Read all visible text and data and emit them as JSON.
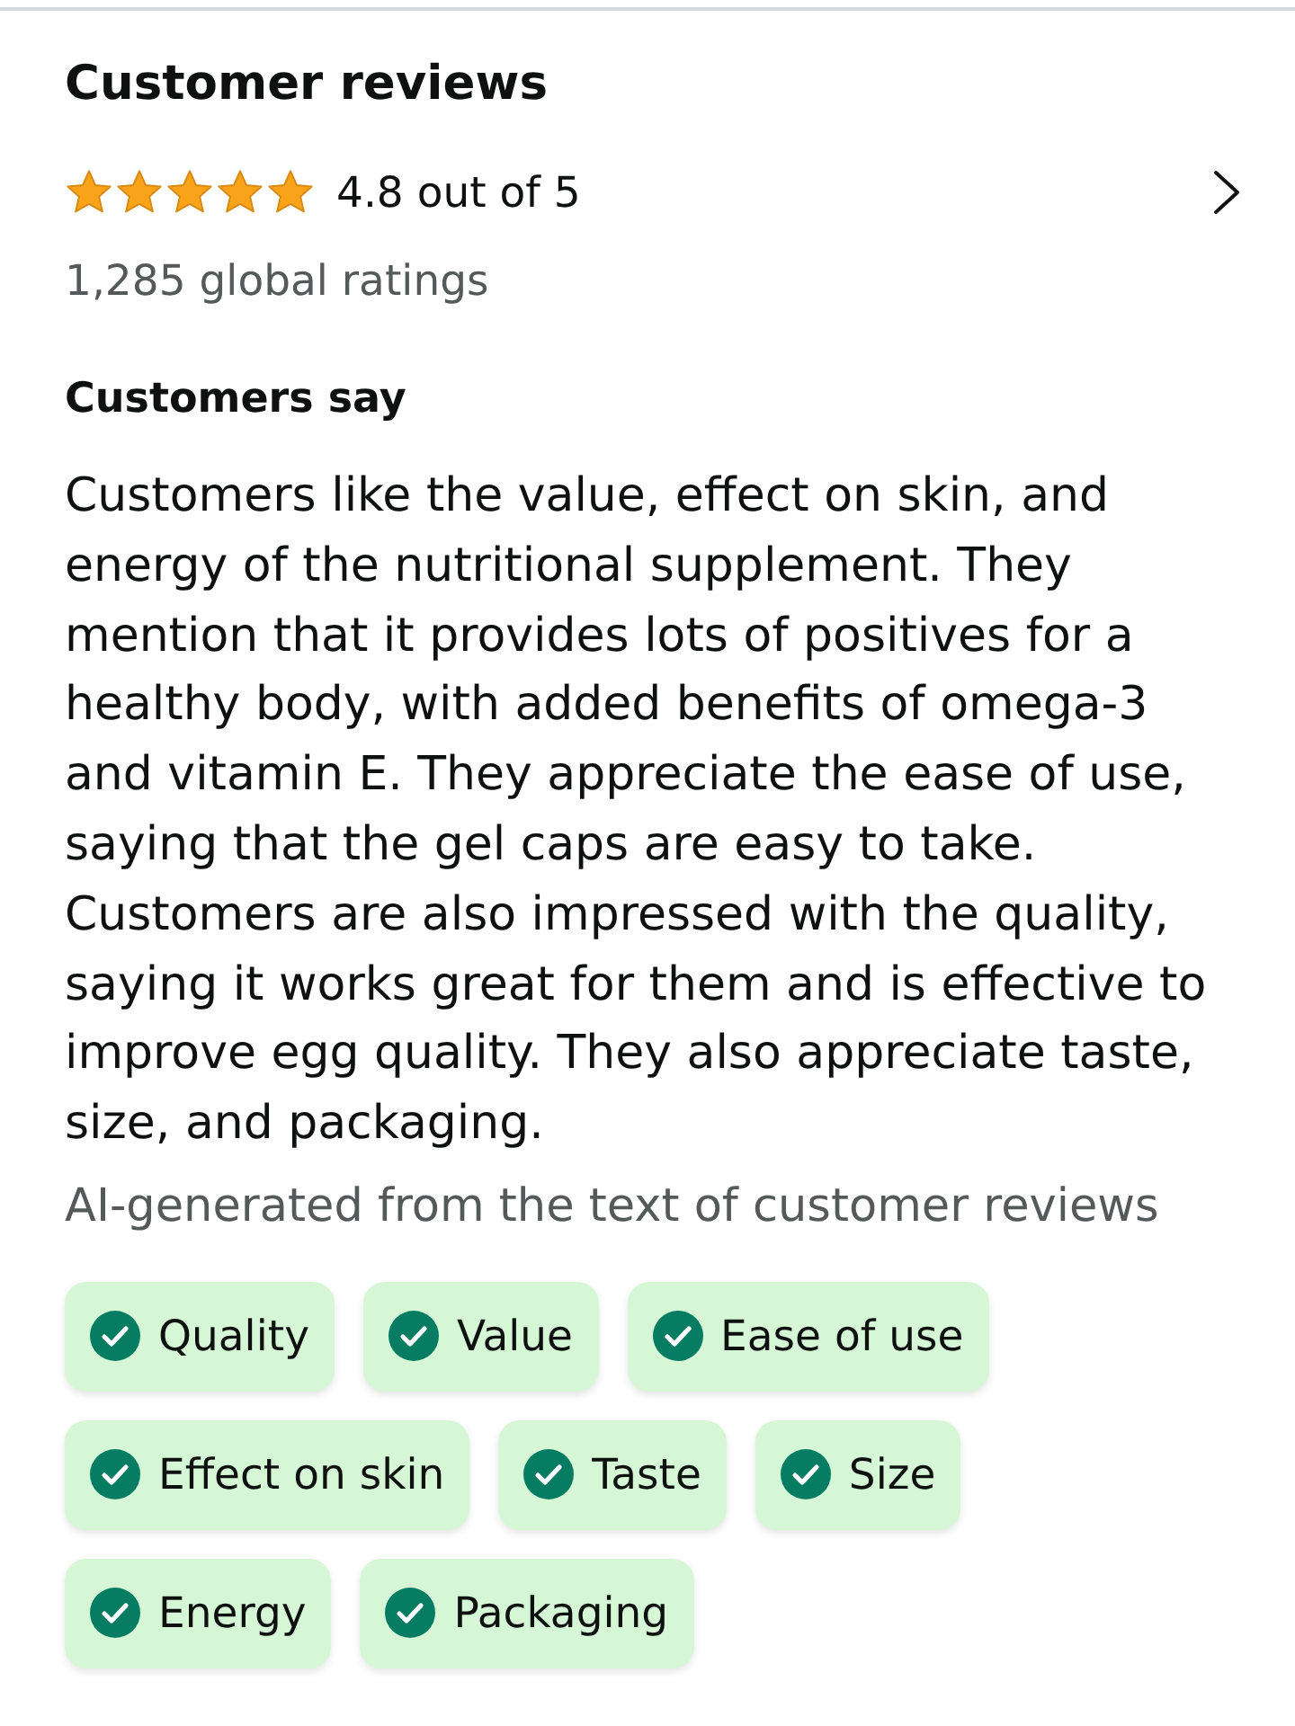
{
  "reviews": {
    "title": "Customer reviews",
    "rating": {
      "stars": 5,
      "text": "4.8 out of 5"
    },
    "global_ratings": "1,285 global ratings"
  },
  "customers_say": {
    "heading": "Customers say",
    "summary": "Customers like the value, effect on skin, and energy of the nutritional supplement. They mention that it provides lots of positives for a healthy body, with added benefits of omega-3 and vitamin E. They appreciate the ease of use, saying that the gel caps are easy to take. Customers are also impressed with the quality, saying it works great for them and is effective to improve egg quality. They also appreciate taste, size, and packaging.",
    "note": "AI-generated from the text of customer reviews",
    "aspects": [
      {
        "label": "Quality"
      },
      {
        "label": "Value"
      },
      {
        "label": "Ease of use"
      },
      {
        "label": "Effect on skin"
      },
      {
        "label": "Taste"
      },
      {
        "label": "Size"
      },
      {
        "label": "Energy"
      },
      {
        "label": "Packaging"
      }
    ]
  }
}
